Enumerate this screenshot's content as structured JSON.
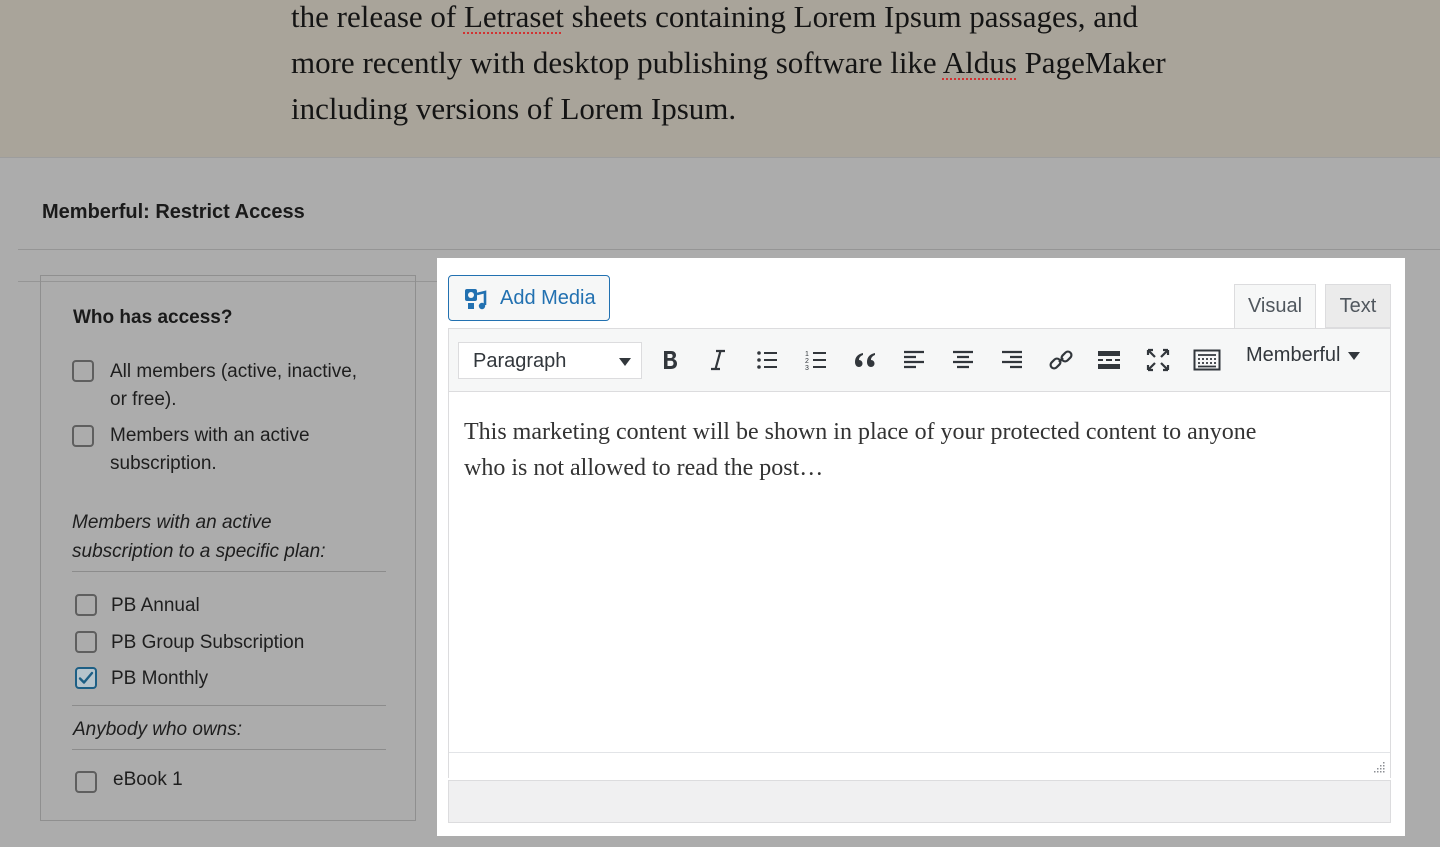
{
  "post_content": {
    "lines": [
      "the release of ",
      "Letraset",
      " sheets containing Lorem Ipsum passages, and",
      "more recently with desktop publishing software like ",
      "Aldus",
      " PageMaker",
      "including versions of Lorem Ipsum."
    ]
  },
  "metabox": {
    "title": "Memberful: Restrict Access"
  },
  "access": {
    "heading": "Who has access?",
    "options": [
      {
        "label_line1": "All members (active, inactive,",
        "label_line2": "or free).",
        "checked": false
      },
      {
        "label_line1": "Members with an active",
        "label_line2": "subscription.",
        "checked": false
      }
    ],
    "plans_heading_line1": "Members with an active",
    "plans_heading_line2": "subscription to a specific plan:",
    "plans": [
      {
        "label": "PB Annual",
        "checked": false
      },
      {
        "label": "PB Group Subscription",
        "checked": false
      },
      {
        "label": "PB Monthly",
        "checked": true
      }
    ],
    "owners_heading": "Anybody who owns:",
    "products": [
      {
        "label": "eBook 1",
        "checked": false
      }
    ]
  },
  "editor": {
    "add_media_label": "Add Media",
    "tabs": {
      "visual": "Visual",
      "text": "Text"
    },
    "format_select_value": "Paragraph",
    "memberful_dropdown": "Memberful",
    "toolbar_icons": [
      "bold-icon",
      "italic-icon",
      "bullet-list-icon",
      "numbered-list-icon",
      "blockquote-icon",
      "align-left-icon",
      "align-center-icon",
      "align-right-icon",
      "link-icon",
      "read-more-icon",
      "fullscreen-icon",
      "toolbar-toggle-icon"
    ],
    "content_line1": "This marketing content will be shown in place of your protected content to anyone",
    "content_line2": "who is not allowed to read the post…",
    "accent_color": "#2271b1"
  }
}
